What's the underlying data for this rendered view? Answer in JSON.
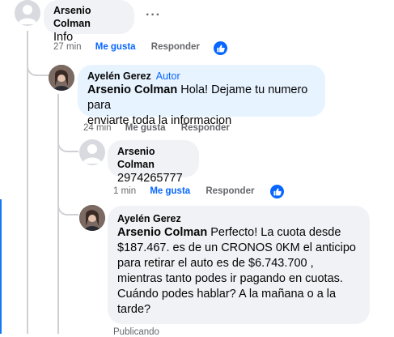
{
  "comments": [
    {
      "author": "Arsenio Colman",
      "text": "Info",
      "time": "27 min",
      "like_label": "Me gusta",
      "reply_label": "Responder",
      "avatar": "default-user-icon"
    },
    {
      "author": "Ayelén Gerez",
      "badge": "Autor",
      "mention": "Arsenio Colman",
      "text_line1": "Hola! Dejame tu numero para",
      "text_line2": "enviarte toda la informacion",
      "time": "24 min",
      "like_label": "Me gusta",
      "reply_label": "Responder",
      "avatar": "profile-photo"
    },
    {
      "author": "Arsenio Colman",
      "text": "2974265777",
      "time": "1 min",
      "like_label": "Me gusta",
      "reply_label": "Responder",
      "avatar": "default-user-icon"
    },
    {
      "author": "Ayelén Gerez",
      "mention": "Arsenio Colman",
      "lines": [
        "Perfecto! La cuota desde",
        "$187.467. es de un CRONOS 0KM el anticipo",
        "para retirar el auto es de $6.743.700 ,",
        "mientras tanto podes ir pagando en cuotas.",
        "Cuándo podes hablar? A la mañana o a la",
        "tarde?"
      ],
      "status": "Publicando",
      "avatar": "profile-photo"
    }
  ],
  "more_options": "···",
  "colors": {
    "accent": "#0866ff",
    "muted": "#65676b",
    "bubble_gray": "#f0f2f5",
    "bubble_blue": "#e7f3ff"
  }
}
